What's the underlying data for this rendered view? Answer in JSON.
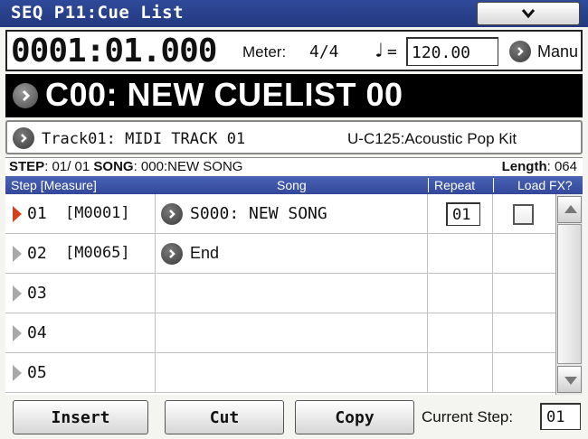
{
  "window": {
    "title": "SEQ P11:Cue List"
  },
  "transport": {
    "location": "0001:01.000",
    "meter_label": "Meter:",
    "meter_value": "4/4",
    "tempo_symbol": "♩",
    "tempo_eq": "=",
    "tempo_value": "120.00",
    "tempo_mode": "Manu"
  },
  "cuelist": {
    "name": "C00: NEW CUELIST 00"
  },
  "track": {
    "name": "Track01: MIDI TRACK 01",
    "program": "U-C125:Acoustic Pop Kit"
  },
  "info": {
    "step_label": "STEP",
    "step_value": ": 01/ 01",
    "song_label": "SONG",
    "song_value": ": 000:NEW SONG",
    "length_label": "Length",
    "length_value": ": 064"
  },
  "columns": {
    "step": "Step [Measure]",
    "song": "Song",
    "repeat": "Repeat",
    "loadfx": "Load FX?"
  },
  "rows": [
    {
      "step": "01",
      "measure": "[M0001]",
      "song": "S000: NEW SONG",
      "repeat": "01",
      "has_fx": true,
      "active": true
    },
    {
      "step": "02",
      "measure": "[M0065]",
      "song": "End",
      "repeat": "",
      "has_fx": false,
      "active": false
    },
    {
      "step": "03",
      "measure": "",
      "song": "",
      "repeat": "",
      "has_fx": false,
      "active": false
    },
    {
      "step": "04",
      "measure": "",
      "song": "",
      "repeat": "",
      "has_fx": false,
      "active": false
    },
    {
      "step": "05",
      "measure": "",
      "song": "",
      "repeat": "",
      "has_fx": false,
      "active": false
    }
  ],
  "buttons": {
    "insert": "Insert",
    "cut": "Cut",
    "copy": "Copy"
  },
  "current_step": {
    "label": "Current Step:",
    "value": "01"
  },
  "colors": {
    "title_bar": "#2f4a9a",
    "active_arrow": "#d2421a",
    "cue_bg": "#000000"
  }
}
